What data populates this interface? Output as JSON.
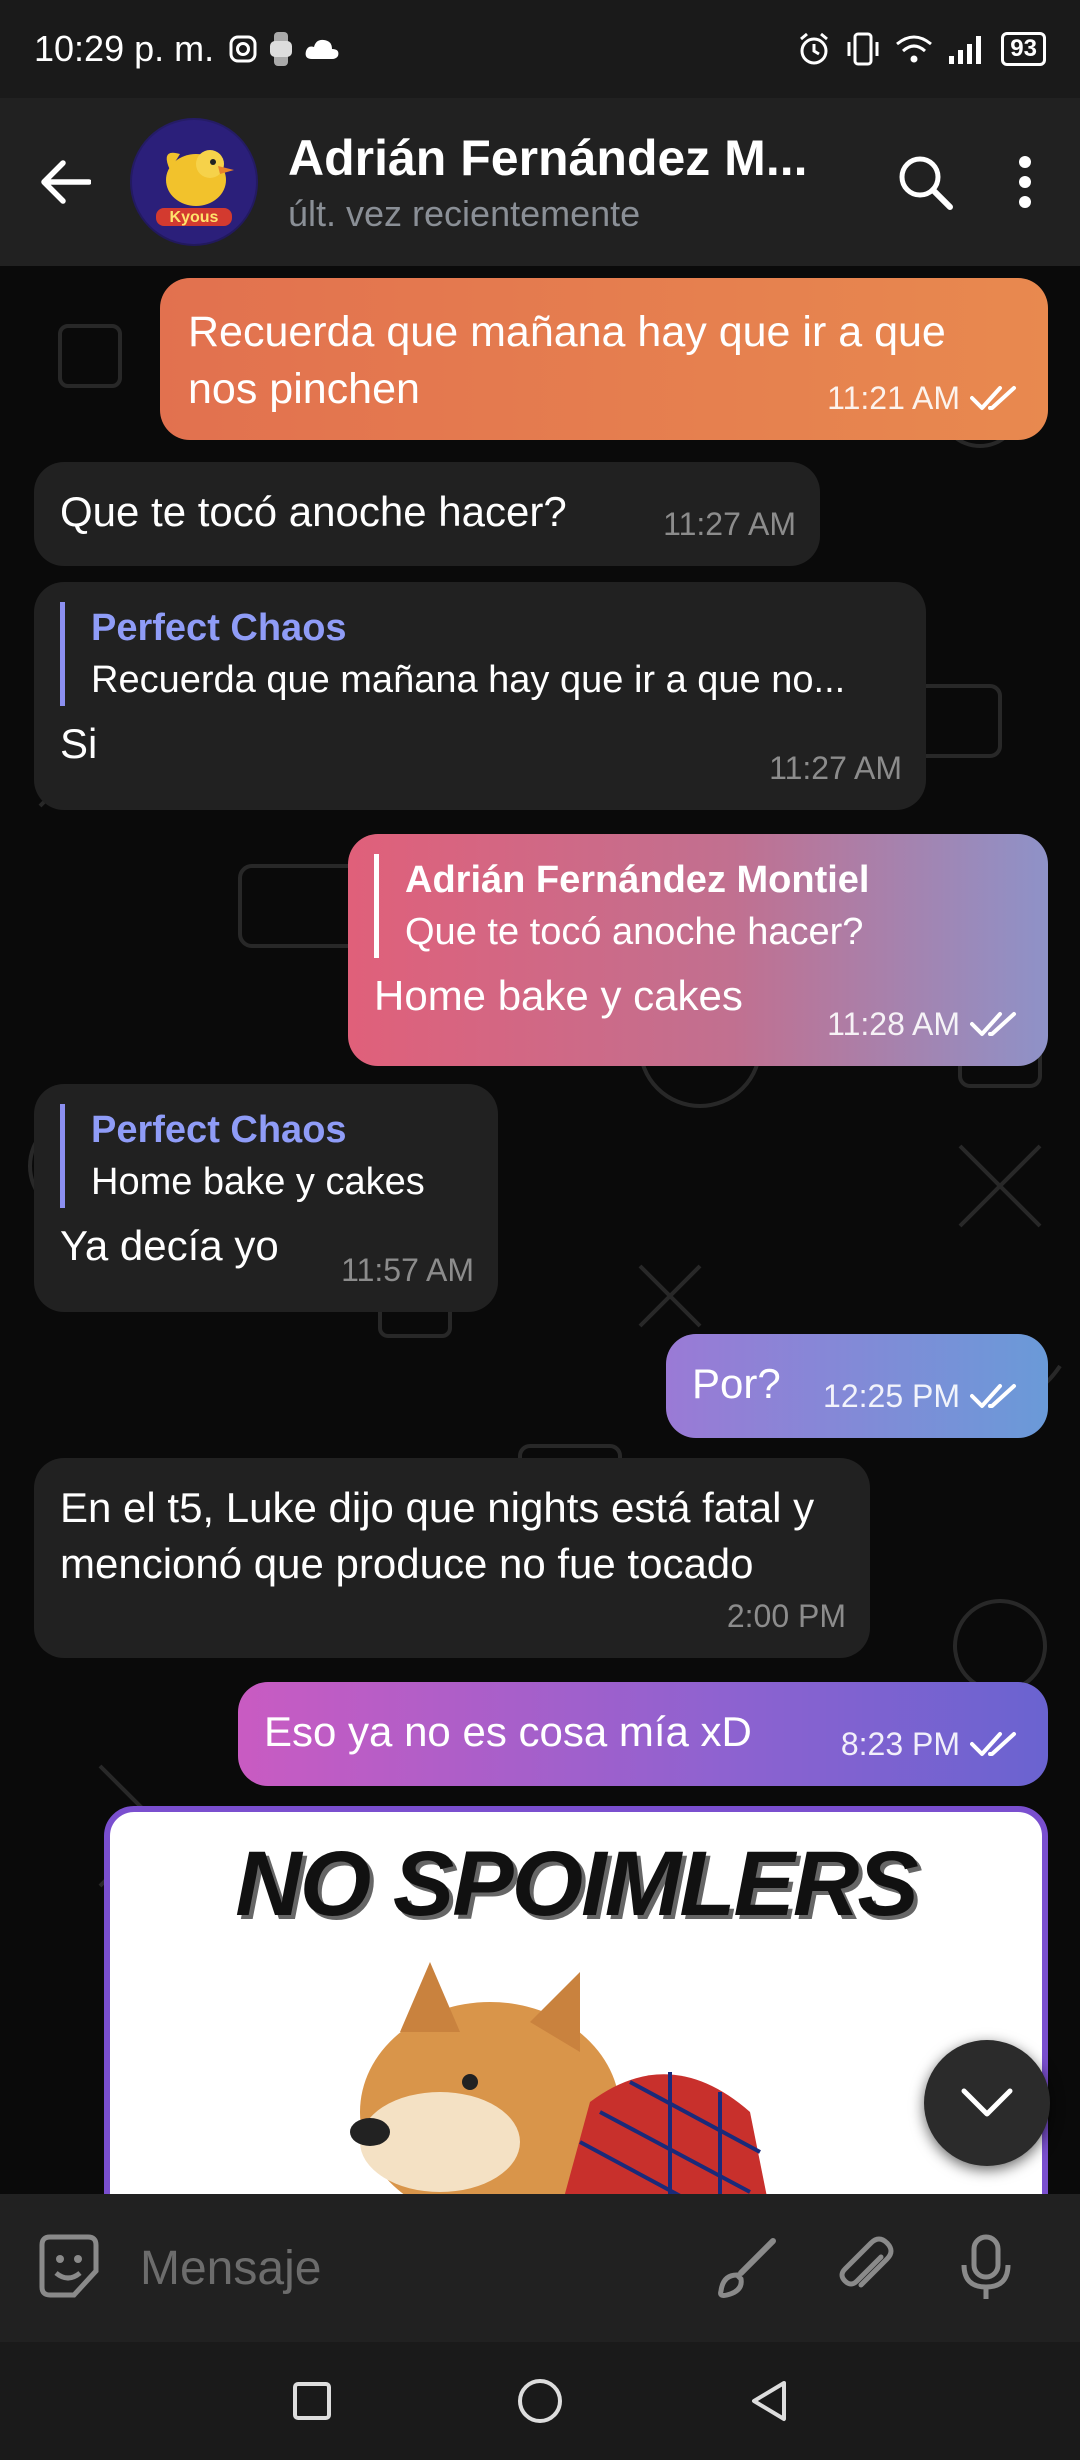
{
  "status_bar": {
    "time": "10:29 p. m.",
    "battery": "93"
  },
  "header": {
    "title": "Adrián Fernández M...",
    "subtitle": "últ. vez recientemente",
    "avatar_text": "Kyous"
  },
  "messages": [
    {
      "dir": "out",
      "text": "Recuerda que mañana hay que ir a que nos pinchen",
      "time": "11:21 AM"
    },
    {
      "dir": "in",
      "text": "Que te tocó anoche hacer?",
      "time": "11:27 AM"
    },
    {
      "dir": "in",
      "reply_name": "Perfect Chaos",
      "reply_text": "Recuerda que mañana hay que ir a que no...",
      "text": "Si",
      "time": "11:27 AM"
    },
    {
      "dir": "out",
      "reply_name": "Adrián Fernández Montiel",
      "reply_text": "Que te tocó anoche hacer?",
      "text": "Home bake y cakes",
      "time": "11:28 AM"
    },
    {
      "dir": "in",
      "reply_name": "Perfect Chaos",
      "reply_text": "Home bake y cakes",
      "text": "Ya decía yo",
      "time": "11:57 AM"
    },
    {
      "dir": "out",
      "text": "Por?",
      "time": "12:25 PM"
    },
    {
      "dir": "in",
      "text": "En el t5, Luke dijo que nights está fatal y mencionó que produce no fue tocado",
      "time": "2:00 PM"
    },
    {
      "dir": "out",
      "text": "Eso ya no es cosa mía xD",
      "time": "8:23 PM"
    }
  ],
  "meme": {
    "caption": "NO SPOIMLERS"
  },
  "input": {
    "placeholder": "Mensaje"
  },
  "colors": {
    "out_gradient_1": "#e0654f",
    "out_gradient_2": "#7a6cd0",
    "in_bubble": "#212121",
    "reply_accent": "#8f9cf7"
  }
}
